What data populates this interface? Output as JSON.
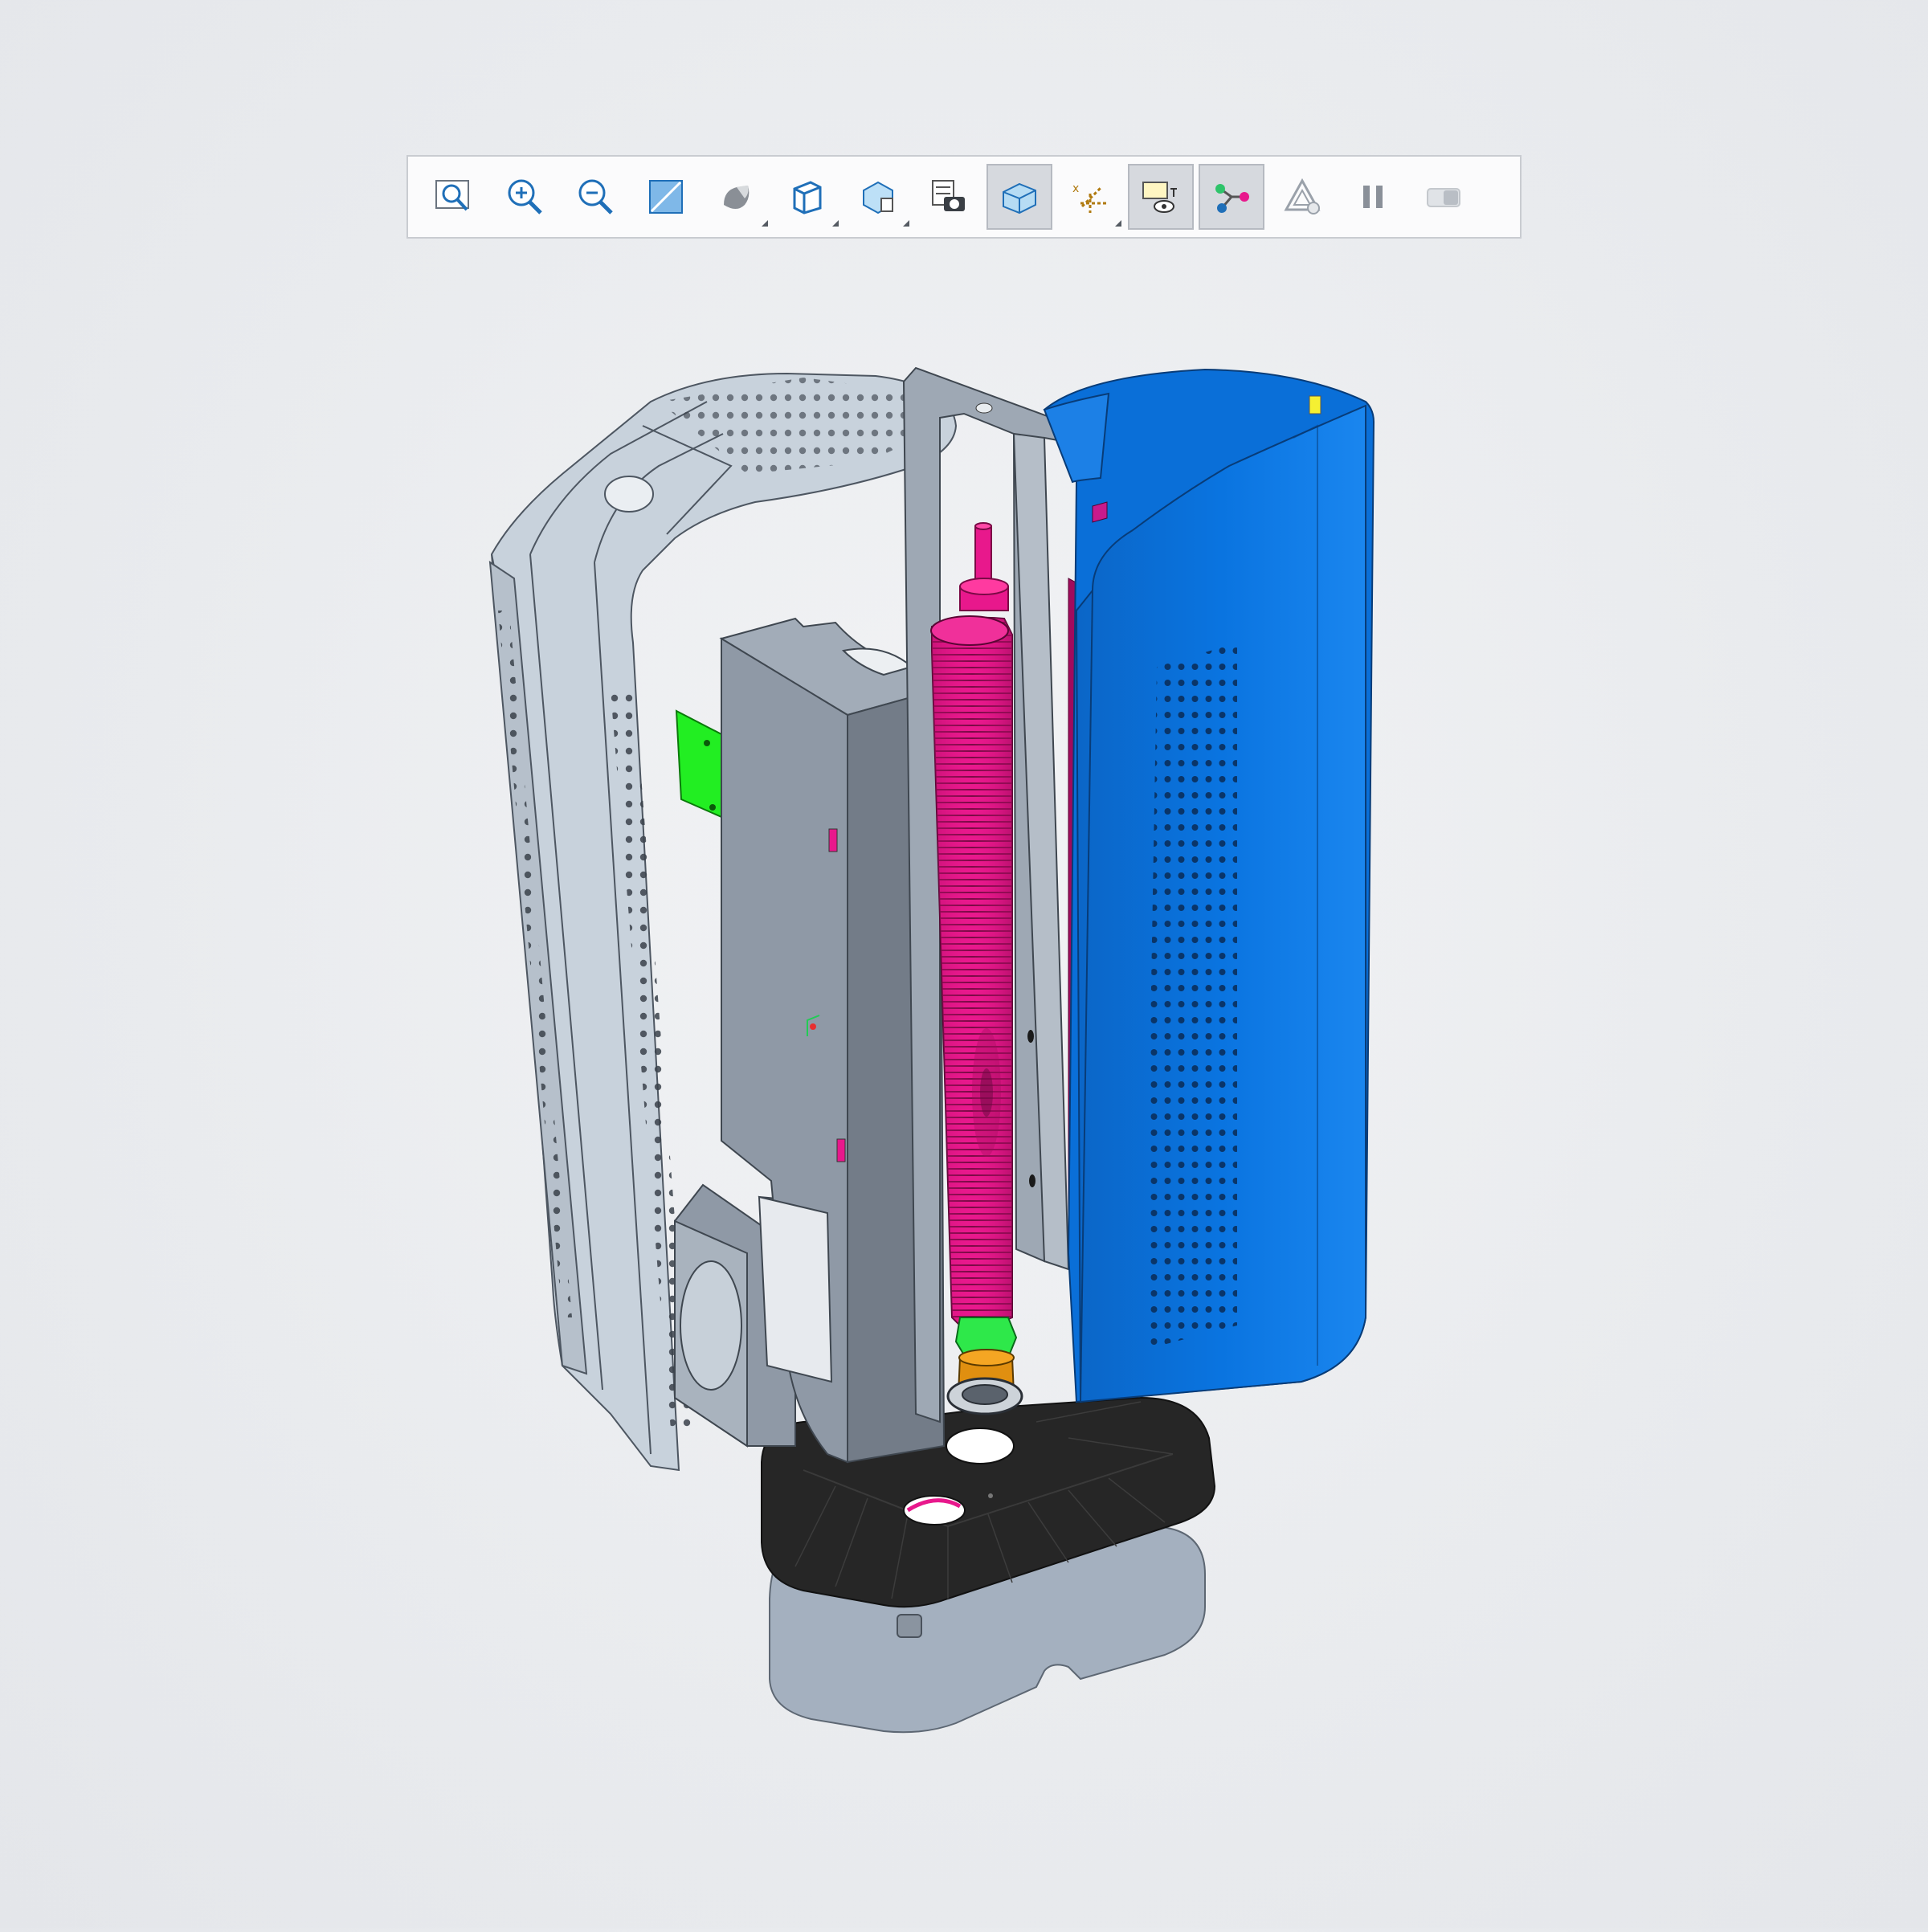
{
  "toolbar": {
    "buttons": [
      {
        "icon": "refit-icon",
        "active": false,
        "has_dropdown": false
      },
      {
        "icon": "zoom-in-icon",
        "active": false,
        "has_dropdown": false
      },
      {
        "icon": "zoom-out-icon",
        "active": false,
        "has_dropdown": false
      },
      {
        "icon": "repaint-icon",
        "active": false,
        "has_dropdown": false
      },
      {
        "icon": "display-style-icon",
        "active": false,
        "has_dropdown": true
      },
      {
        "icon": "saved-orientations-icon",
        "active": false,
        "has_dropdown": true
      },
      {
        "icon": "view-manager-icon",
        "active": false,
        "has_dropdown": true
      },
      {
        "icon": "perspective-view-icon",
        "active": false,
        "has_dropdown": false
      },
      {
        "icon": "section-view-icon",
        "active": true,
        "has_dropdown": false
      },
      {
        "icon": "datum-display-icon",
        "active": false,
        "has_dropdown": true
      },
      {
        "icon": "annotation-display-icon",
        "active": true,
        "has_dropdown": false
      },
      {
        "icon": "explode-view-icon",
        "active": true,
        "has_dropdown": false
      },
      {
        "icon": "spin-center-icon",
        "active": false,
        "has_dropdown": false
      },
      {
        "icon": "pause-icon",
        "active": false,
        "has_dropdown": false
      },
      {
        "icon": "toggle-view-icon",
        "active": false,
        "has_dropdown": false
      }
    ]
  },
  "model": {
    "colors": {
      "background": "#e9ebee",
      "shell_blue": "#0a72dd",
      "heater_magenta": "#e8188c",
      "frame_grey": "#8f99a6",
      "side_panel": "#c8d2dc",
      "base_black": "#262626",
      "bracket_green": "#22ee22",
      "bottom_plate": "#a4b0bf"
    }
  }
}
